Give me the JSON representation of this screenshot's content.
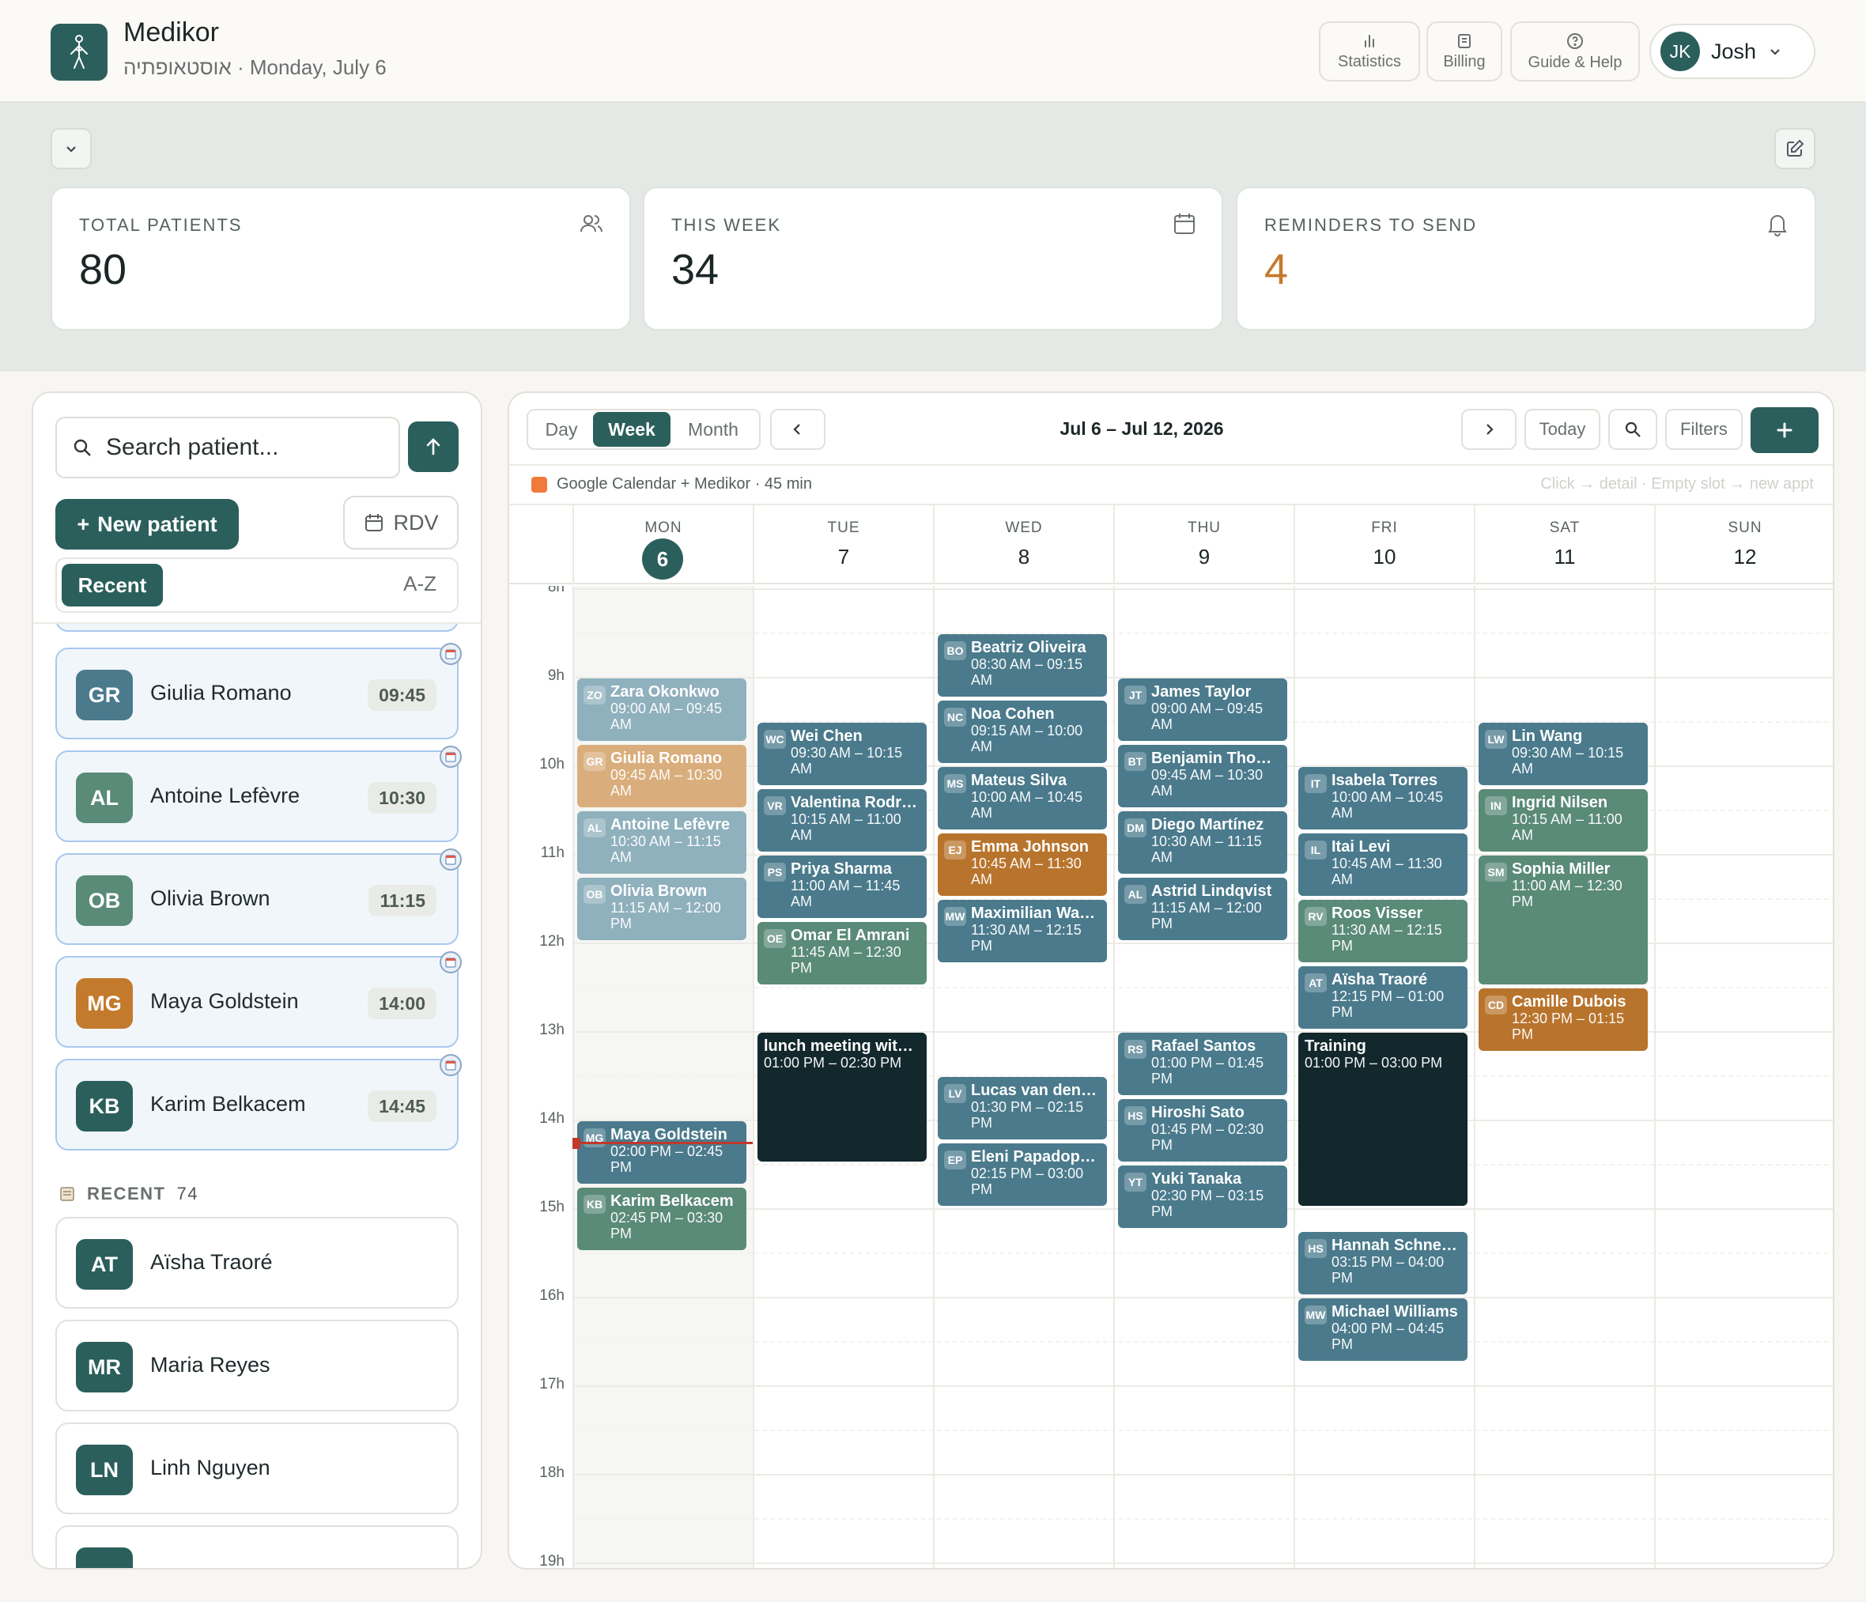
{
  "header": {
    "app_name": "Medikor",
    "subtitle": "אוסטאופתיה · Monday, July 6",
    "nav": [
      {
        "label": "Statistics",
        "icon": "bar-chart-icon"
      },
      {
        "label": "Billing",
        "icon": "receipt-icon"
      },
      {
        "label": "Guide & Help",
        "icon": "help-circle-icon"
      }
    ],
    "user": {
      "initials": "JK",
      "name": "Josh"
    }
  },
  "stats": [
    {
      "label": "TOTAL PATIENTS",
      "value": "80",
      "icon": "users-icon"
    },
    {
      "label": "THIS WEEK",
      "value": "34",
      "icon": "calendar-icon"
    },
    {
      "label": "REMINDERS TO SEND",
      "value": "4",
      "icon": "bell-icon",
      "color": "#c47a2c"
    }
  ],
  "sidebar": {
    "search_placeholder": "Search patient...",
    "new_patient": "New patient",
    "new_patient_plus": "+",
    "rdv": "RDV",
    "sort_recent": "Recent",
    "sort_az": "A-Z",
    "today": [
      {
        "initials": "GR",
        "name": "Giulia Romano",
        "time": "09:45",
        "color": "#4a7a8c"
      },
      {
        "initials": "AL",
        "name": "Antoine Lefèvre",
        "time": "10:30",
        "color": "#5a8a78"
      },
      {
        "initials": "OB",
        "name": "Olivia Brown",
        "time": "11:15",
        "color": "#5a8a78"
      },
      {
        "initials": "MG",
        "name": "Maya Goldstein",
        "time": "14:00",
        "color": "#c47a2c"
      },
      {
        "initials": "KB",
        "name": "Karim Belkacem",
        "time": "14:45",
        "color": "#2b5f5c"
      }
    ],
    "recent_label": "RECENT",
    "recent_count": "74",
    "recent": [
      {
        "initials": "AT",
        "name": "Aïsha Traoré",
        "color": "#2b5f5c"
      },
      {
        "initials": "MR",
        "name": "Maria Reyes",
        "color": "#2b5f5c"
      },
      {
        "initials": "LN",
        "name": "Linh Nguyen",
        "color": "#2b5f5c"
      }
    ]
  },
  "calendar": {
    "views": [
      "Day",
      "Week",
      "Month"
    ],
    "active_view": "Week",
    "range": "Jul 6 – Jul 12, 2026",
    "today_label": "Today",
    "filters_label": "Filters",
    "source": "Google Calendar + Medikor · 45 min",
    "hint": "Click → detail · Empty slot → new appt",
    "days": [
      {
        "name": "MON",
        "date": "6",
        "today": true
      },
      {
        "name": "TUE",
        "date": "7"
      },
      {
        "name": "WED",
        "date": "8"
      },
      {
        "name": "THU",
        "date": "9"
      },
      {
        "name": "FRI",
        "date": "10"
      },
      {
        "name": "SAT",
        "date": "11"
      },
      {
        "name": "SUN",
        "date": "12"
      }
    ],
    "hours": [
      "8h",
      "9h",
      "10h",
      "11h",
      "12h",
      "13h",
      "14h",
      "15h",
      "16h",
      "17h",
      "18h",
      "19h"
    ],
    "events": [
      {
        "day": 0,
        "start": 9.0,
        "end": 9.75,
        "ini": "ZO",
        "name": "Zara Okonkwo",
        "time": "09:00 AM – 09:45 AM",
        "color": "#8fb0bd"
      },
      {
        "day": 0,
        "start": 9.75,
        "end": 10.5,
        "ini": "GR",
        "name": "Giulia Romano",
        "time": "09:45 AM – 10:30 AM",
        "color": "#d9ae7c"
      },
      {
        "day": 0,
        "start": 10.5,
        "end": 11.25,
        "ini": "AL",
        "name": "Antoine Lefèvre",
        "time": "10:30 AM – 11:15 AM",
        "color": "#8fb0bd"
      },
      {
        "day": 0,
        "start": 11.25,
        "end": 12.0,
        "ini": "OB",
        "name": "Olivia Brown",
        "time": "11:15 AM – 12:00 PM",
        "color": "#8fb0bd"
      },
      {
        "day": 0,
        "start": 14.0,
        "end": 14.75,
        "ini": "MG",
        "name": "Maya Goldstein",
        "time": "02:00 PM – 02:45 PM",
        "color": "#4a7a8c"
      },
      {
        "day": 0,
        "start": 14.75,
        "end": 15.5,
        "ini": "KB",
        "name": "Karim Belkacem",
        "time": "02:45 PM – 03:30 PM",
        "color": "#5a8a78"
      },
      {
        "day": 1,
        "start": 9.5,
        "end": 10.25,
        "ini": "WC",
        "name": "Wei Chen",
        "time": "09:30 AM – 10:15 AM",
        "color": "#4a7a8c"
      },
      {
        "day": 1,
        "start": 10.25,
        "end": 11.0,
        "ini": "VR",
        "name": "Valentina Rodr…",
        "time": "10:15 AM – 11:00 AM",
        "color": "#4a7a8c"
      },
      {
        "day": 1,
        "start": 11.0,
        "end": 11.75,
        "ini": "PS",
        "name": "Priya Sharma",
        "time": "11:00 AM – 11:45 AM",
        "color": "#4a7a8c"
      },
      {
        "day": 1,
        "start": 11.75,
        "end": 12.5,
        "ini": "OE",
        "name": "Omar El Amrani",
        "time": "11:45 AM – 12:30 PM",
        "color": "#5a8a78"
      },
      {
        "day": 1,
        "start": 13.0,
        "end": 14.5,
        "ini": "",
        "name": "lunch meeting wit…",
        "time": "01:00 PM – 02:30 PM",
        "color": "#12282d",
        "block": true
      },
      {
        "day": 2,
        "start": 8.5,
        "end": 9.25,
        "ini": "BO",
        "name": "Beatriz Oliveira",
        "time": "08:30 AM – 09:15 AM",
        "color": "#4a7a8c"
      },
      {
        "day": 2,
        "start": 9.25,
        "end": 10.0,
        "ini": "NC",
        "name": "Noa Cohen",
        "time": "09:15 AM – 10:00 AM",
        "color": "#4a7a8c"
      },
      {
        "day": 2,
        "start": 10.0,
        "end": 10.75,
        "ini": "MS",
        "name": "Mateus Silva",
        "time": "10:00 AM – 10:45 AM",
        "color": "#4a7a8c"
      },
      {
        "day": 2,
        "start": 10.75,
        "end": 11.5,
        "ini": "EJ",
        "name": "Emma Johnson",
        "time": "10:45 AM – 11:30 AM",
        "color": "#b8742c"
      },
      {
        "day": 2,
        "start": 11.5,
        "end": 12.25,
        "ini": "MW",
        "name": "Maximilian Wa…",
        "time": "11:30 AM – 12:15 PM",
        "color": "#4a7a8c"
      },
      {
        "day": 2,
        "start": 13.5,
        "end": 14.25,
        "ini": "LV",
        "name": "Lucas van den …",
        "time": "01:30 PM – 02:15 PM",
        "color": "#4a7a8c"
      },
      {
        "day": 2,
        "start": 14.25,
        "end": 15.0,
        "ini": "EP",
        "name": "Eleni Papadop…",
        "time": "02:15 PM – 03:00 PM",
        "color": "#4a7a8c"
      },
      {
        "day": 3,
        "start": 9.0,
        "end": 9.75,
        "ini": "JT",
        "name": "James Taylor",
        "time": "09:00 AM – 09:45 AM",
        "color": "#4a7a8c"
      },
      {
        "day": 3,
        "start": 9.75,
        "end": 10.5,
        "ini": "BT",
        "name": "Benjamin Tho…",
        "time": "09:45 AM – 10:30 AM",
        "color": "#4a7a8c"
      },
      {
        "day": 3,
        "start": 10.5,
        "end": 11.25,
        "ini": "DM",
        "name": "Diego Martínez",
        "time": "10:30 AM – 11:15 AM",
        "color": "#4a7a8c"
      },
      {
        "day": 3,
        "start": 11.25,
        "end": 12.0,
        "ini": "AL",
        "name": "Astrid Lindqvist",
        "time": "11:15 AM – 12:00 PM",
        "color": "#4a7a8c"
      },
      {
        "day": 3,
        "start": 13.0,
        "end": 13.75,
        "ini": "RS",
        "name": "Rafael Santos",
        "time": "01:00 PM – 01:45 PM",
        "color": "#4a7a8c"
      },
      {
        "day": 3,
        "start": 13.75,
        "end": 14.5,
        "ini": "HS",
        "name": "Hiroshi Sato",
        "time": "01:45 PM – 02:30 PM",
        "color": "#4a7a8c"
      },
      {
        "day": 3,
        "start": 14.5,
        "end": 15.25,
        "ini": "YT",
        "name": "Yuki Tanaka",
        "time": "02:30 PM – 03:15 PM",
        "color": "#4a7a8c"
      },
      {
        "day": 4,
        "start": 10.0,
        "end": 10.75,
        "ini": "IT",
        "name": "Isabela Torres",
        "time": "10:00 AM – 10:45 AM",
        "color": "#4a7a8c"
      },
      {
        "day": 4,
        "start": 10.75,
        "end": 11.5,
        "ini": "IL",
        "name": "Itai Levi",
        "time": "10:45 AM – 11:30 AM",
        "color": "#4a7a8c"
      },
      {
        "day": 4,
        "start": 11.5,
        "end": 12.25,
        "ini": "RV",
        "name": "Roos Visser",
        "time": "11:30 AM – 12:15 PM",
        "color": "#5a8a78"
      },
      {
        "day": 4,
        "start": 12.25,
        "end": 13.0,
        "ini": "AT",
        "name": "Aïsha Traoré",
        "time": "12:15 PM – 01:00 PM",
        "color": "#4a7a8c"
      },
      {
        "day": 4,
        "start": 13.0,
        "end": 15.0,
        "ini": "",
        "name": "Training",
        "time": "01:00 PM – 03:00 PM",
        "color": "#12282d",
        "block": true
      },
      {
        "day": 4,
        "start": 15.25,
        "end": 16.0,
        "ini": "HS",
        "name": "Hannah Schnei…",
        "time": "03:15 PM – 04:00 PM",
        "color": "#4a7a8c"
      },
      {
        "day": 4,
        "start": 16.0,
        "end": 16.75,
        "ini": "MW",
        "name": "Michael Williams",
        "time": "04:00 PM – 04:45 PM",
        "color": "#4a7a8c"
      },
      {
        "day": 5,
        "start": 9.5,
        "end": 10.25,
        "ini": "LW",
        "name": "Lin Wang",
        "time": "09:30 AM – 10:15 AM",
        "color": "#4a7a8c"
      },
      {
        "day": 5,
        "start": 10.25,
        "end": 11.0,
        "ini": "IN",
        "name": "Ingrid Nilsen",
        "time": "10:15 AM – 11:00 AM",
        "color": "#5a8a78"
      },
      {
        "day": 5,
        "start": 11.0,
        "end": 12.5,
        "ini": "SM",
        "name": "Sophia Miller",
        "time": "11:00 AM – 12:30 PM",
        "color": "#5a8a78"
      },
      {
        "day": 5,
        "start": 12.5,
        "end": 13.25,
        "ini": "CD",
        "name": "Camille Dubois",
        "time": "12:30 PM – 01:15 PM",
        "color": "#b8742c"
      }
    ],
    "now_hour": 14.25
  }
}
